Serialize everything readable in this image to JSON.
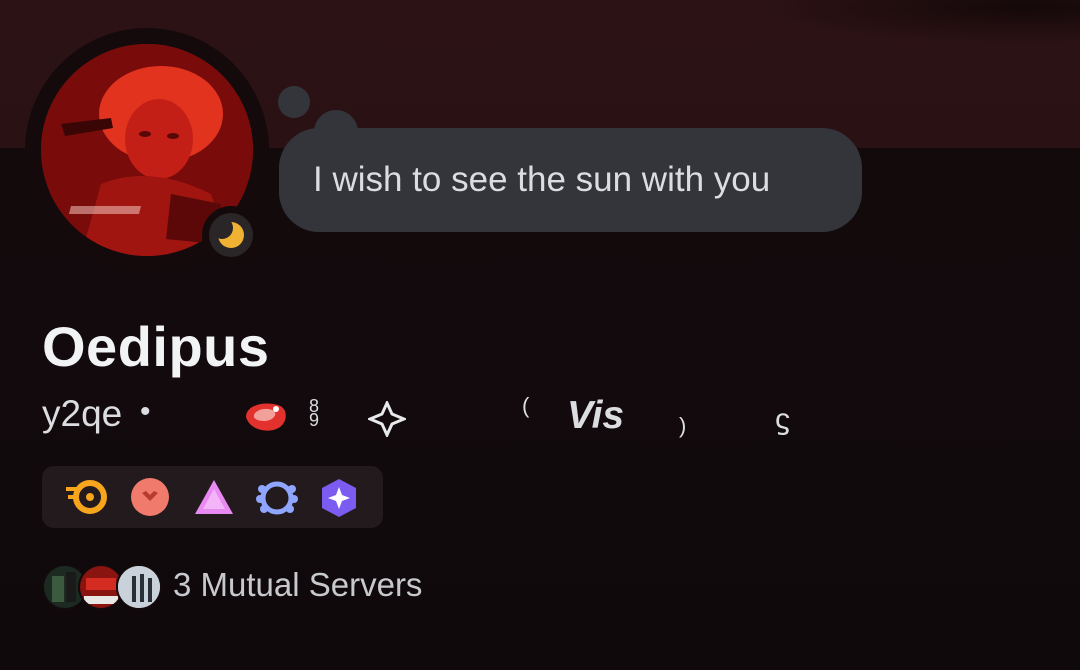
{
  "profile": {
    "display_name": "Oedipus",
    "username": "y2qe",
    "separator": "•",
    "status_message": "I wish to see the sun with you",
    "status": "idle",
    "pronoun_row": {
      "glyph_a": "8\n9",
      "paren_left": "(",
      "vis_text": "Vis",
      "paren_right": ")",
      "squiggle": "ϛ"
    }
  },
  "icons": {
    "status": "moon-icon",
    "decor": [
      "meat-icon",
      "sparkle-icon"
    ],
    "badges": [
      "nitro-icon",
      "boost-icon",
      "hypesquad-icon",
      "laurel-icon",
      "quest-icon"
    ]
  },
  "mutual": {
    "label": "3 Mutual Servers",
    "count": 3
  },
  "colors": {
    "background": "#140a0c",
    "banner": "#2c1214",
    "bubble": "#33353b",
    "idle": "#f0b232",
    "accent_red": "#e3322e"
  }
}
